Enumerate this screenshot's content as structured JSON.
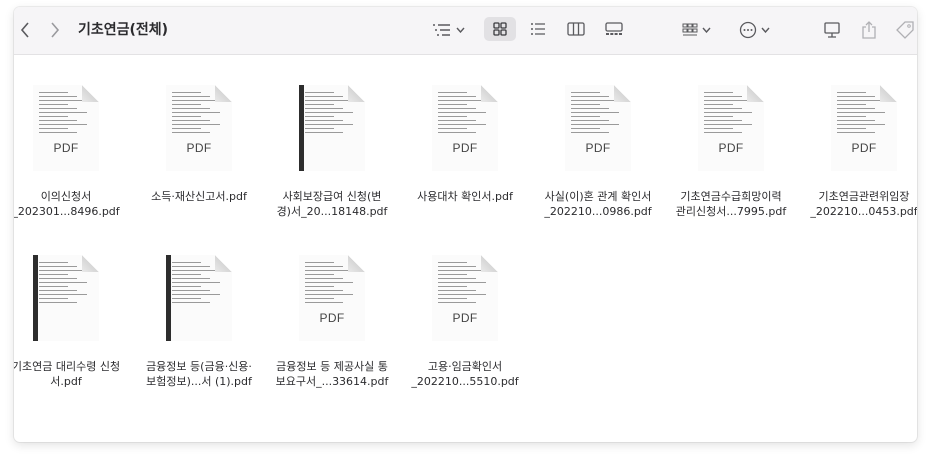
{
  "toolbar": {
    "back_icon": "chevron-left-icon",
    "forward_icon": "chevron-right-icon",
    "title": "기초연금(전체)"
  },
  "files": [
    {
      "name": "이의신청서\n_202301...8496.pdf",
      "type": "PDF"
    },
    {
      "name": "소득·재산신고서.pdf",
      "type": "PDF"
    },
    {
      "name": "사회보장급여 신청(변\n경)서_20...18148.pdf",
      "type": ""
    },
    {
      "name": "사용대차 확인서.pdf",
      "type": "PDF"
    },
    {
      "name": "사실(이)혼 관계 확인서\n_202210...0986.pdf",
      "type": "PDF"
    },
    {
      "name": "기초연금수급희망이력\n관리신청서...7995.pdf",
      "type": "PDF"
    },
    {
      "name": "기초연금관련위임장\n_202210...0453.pdf",
      "type": "PDF"
    },
    {
      "name": "기초연금 대리수령 신청\n서.pdf",
      "type": ""
    },
    {
      "name": "금융정보 등(금융·신용·\n보험정보)...서 (1).pdf",
      "type": ""
    },
    {
      "name": "금융정보 등 제공사실 통\n보요구서_...33614.pdf",
      "type": "PDF"
    },
    {
      "name": "고용·임금확인서\n_202210...5510.pdf",
      "type": "PDF"
    }
  ]
}
